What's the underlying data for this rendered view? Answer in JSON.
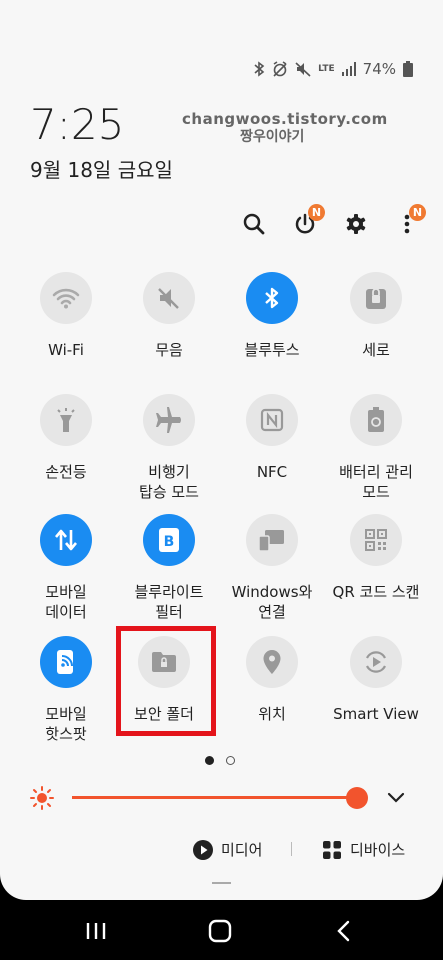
{
  "status": {
    "network": "LTE",
    "battery": "74%"
  },
  "clock": {
    "time": "7:25",
    "date": "9월 18일 금요일"
  },
  "watermark": {
    "line1": "changwoos.tistory.com",
    "line2": "짱우이야기"
  },
  "top_icons": {
    "power_badge": "N",
    "more_badge": "N"
  },
  "tiles": [
    {
      "label": "Wi-Fi",
      "icon": "wifi-icon",
      "on": false
    },
    {
      "label": "무음",
      "icon": "mute-icon",
      "on": false
    },
    {
      "label": "블루투스",
      "icon": "bluetooth-icon",
      "on": true
    },
    {
      "label": "세로",
      "icon": "rotation-lock-icon",
      "on": false
    },
    {
      "label": "손전등",
      "icon": "flashlight-icon",
      "on": false
    },
    {
      "label": "비행기\n탑승 모드",
      "icon": "airplane-icon",
      "on": false
    },
    {
      "label": "NFC",
      "icon": "nfc-icon",
      "on": false
    },
    {
      "label": "배터리 관리\n모드",
      "icon": "battery-saver-icon",
      "on": false
    },
    {
      "label": "모바일\n데이터",
      "icon": "mobile-data-icon",
      "on": true
    },
    {
      "label": "블루라이트\n필터",
      "icon": "blue-light-filter-icon",
      "on": true
    },
    {
      "label": "Windows와\n연결",
      "icon": "link-to-windows-icon",
      "on": false
    },
    {
      "label": "QR 코드 스캔",
      "icon": "qr-code-icon",
      "on": false
    },
    {
      "label": "모바일\n핫스팟",
      "icon": "hotspot-icon",
      "on": true
    },
    {
      "label": "보안 폴더",
      "icon": "secure-folder-icon",
      "on": false
    },
    {
      "label": "위치",
      "icon": "location-icon",
      "on": false
    },
    {
      "label": "Smart View",
      "icon": "smart-view-icon",
      "on": false
    }
  ],
  "pager": {
    "current": 1,
    "total": 2
  },
  "brightness": {
    "level": 1.0
  },
  "media": {
    "media_label": "미디어",
    "devices_label": "디바이스"
  },
  "colors": {
    "accent": "#1a8cf2",
    "brightness": "#f2542d",
    "badge": "#f07a32",
    "highlight": "#e4141b"
  }
}
